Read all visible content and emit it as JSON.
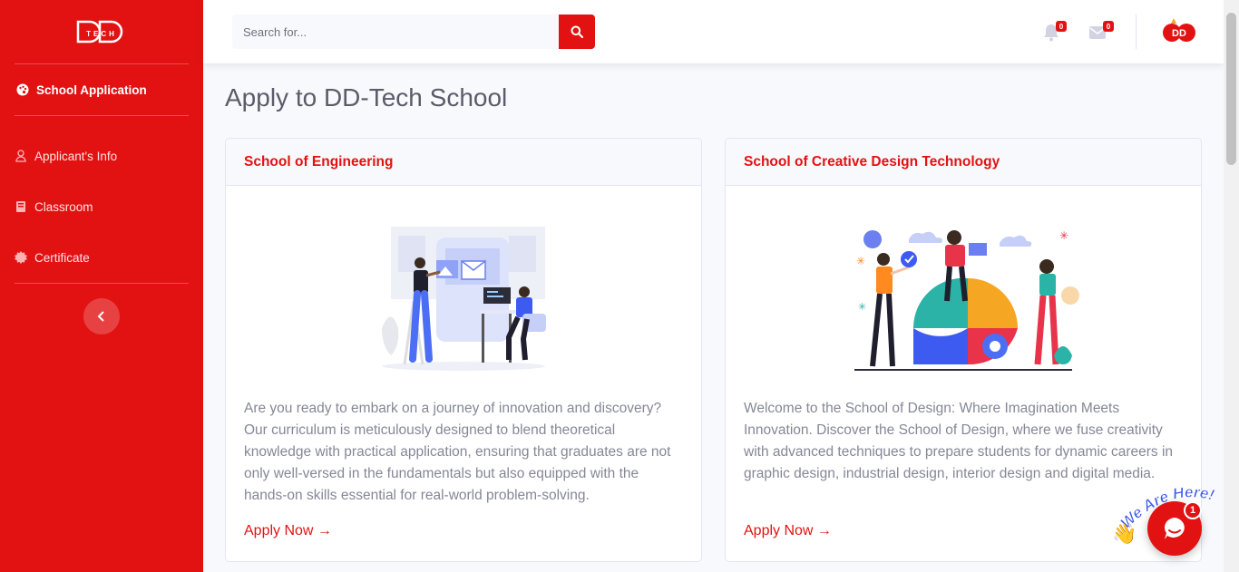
{
  "brand": {
    "logo_text": "TECH"
  },
  "sidebar": {
    "active_item": {
      "label": "School Application",
      "icon": "palette-icon"
    },
    "items": [
      {
        "label": "Applicant's Info",
        "icon": "user-icon"
      },
      {
        "label": "Classroom",
        "icon": "book-icon"
      },
      {
        "label": "Certificate",
        "icon": "certificate-icon"
      }
    ],
    "toggle_icon": "chevron-left-icon"
  },
  "topbar": {
    "search": {
      "placeholder": "Search for...",
      "value": ""
    },
    "alerts_count": "0",
    "messages_count": "0",
    "avatar_text": "DD"
  },
  "page": {
    "title": "Apply to DD-Tech School"
  },
  "cards": [
    {
      "title": "School of Engineering",
      "description": "Are you ready to embark on a journey of innovation and discovery? Our curriculum is meticulously designed to blend theoretical knowledge with practical application, ensuring that graduates are not only well-versed in the fundamentals but also equipped with the hands-on skills essential for real-world problem-solving.",
      "link": "Apply Now →"
    },
    {
      "title": "School of Creative Design Technology",
      "description": "Welcome to the School of Design: Where Imagination Meets Innovation. Discover the School of Design, where we fuse creativity with advanced techniques to prepare students for dynamic careers in graphic design, industrial design, interior design and digital media.",
      "link": "Apply Now →"
    }
  ],
  "chat": {
    "banner": "We Are Here!",
    "unread": "1"
  },
  "colors": {
    "brand_red": "#e31212",
    "text_gray": "#858796",
    "title_gray": "#5a5c69"
  }
}
